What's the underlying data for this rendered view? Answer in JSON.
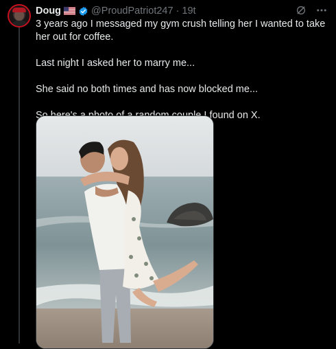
{
  "tweet": {
    "author_name": "Doug",
    "author_handle": "@ProudPatriot247",
    "separator": "·",
    "time": "19t",
    "paragraphs": [
      "3 years ago I messaged my gym crush telling her I wanted to take her out for coffee.",
      "Last night I asked her to marry me...",
      "She said no both times and has now blocked me...",
      "So here's a photo of a random couple I found on X."
    ],
    "flag_icon": "us-flag-icon",
    "verified_icon": "verified-badge-icon",
    "media_description_icon": "couple-beach-photo"
  },
  "colors": {
    "background": "#000000",
    "text": "#e7e9ea",
    "muted": "#71767b",
    "verified": "#1d9bf0",
    "avatar_ring": "#c8101e"
  }
}
